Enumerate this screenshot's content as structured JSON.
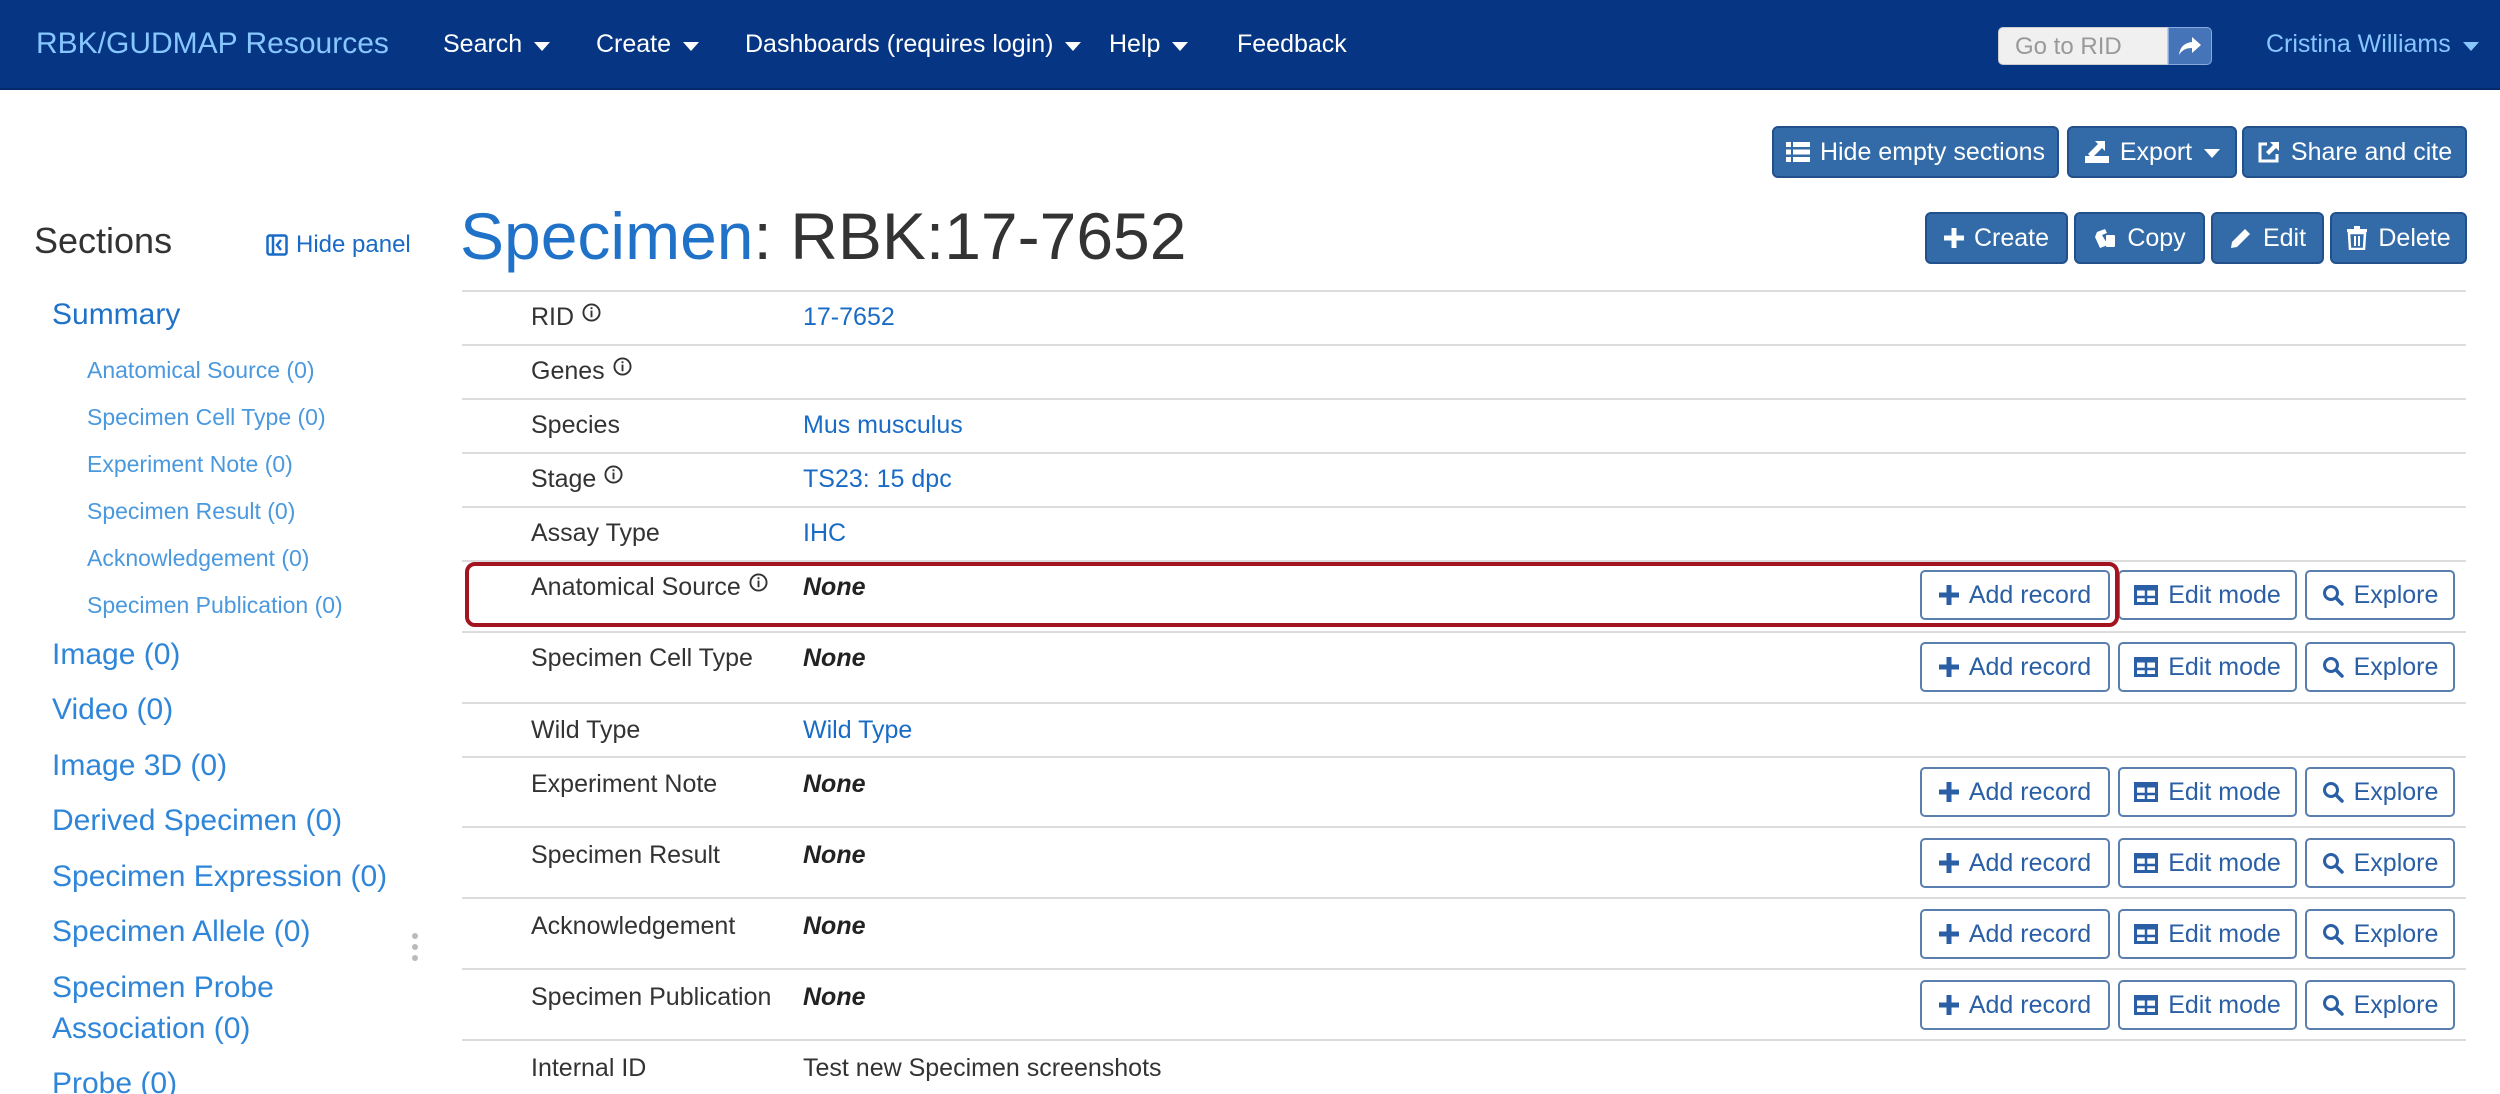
{
  "navbar": {
    "brand": "RBK/GUDMAP Resources",
    "menus": [
      {
        "label": "Search",
        "has_dropdown": true
      },
      {
        "label": "Create",
        "has_dropdown": true
      },
      {
        "label": "Dashboards (requires login)",
        "has_dropdown": true
      },
      {
        "label": "Help",
        "has_dropdown": true
      },
      {
        "label": "Feedback",
        "has_dropdown": false
      }
    ],
    "go_to_rid_placeholder": "Go to RID",
    "user": "Cristina Williams"
  },
  "page_actions": {
    "hide_empty": "Hide empty sections",
    "export": "Export",
    "share": "Share and cite"
  },
  "record_actions": {
    "create": "Create",
    "copy": "Copy",
    "edit": "Edit",
    "delete": "Delete"
  },
  "sidebar": {
    "title": "Sections",
    "hide_panel": "Hide panel",
    "summary": "Summary",
    "sub_items": [
      "Anatomical Source (0)",
      "Specimen Cell Type (0)",
      "Experiment Note (0)",
      "Specimen Result (0)",
      "Acknowledgement (0)",
      "Specimen Publication (0)"
    ],
    "main_items": [
      "Image (0)",
      "Video (0)",
      "Image 3D (0)",
      "Derived Specimen (0)",
      "Specimen Expression (0)",
      "Specimen Allele (0)",
      "Specimen Probe",
      "Association (0)",
      "Probe (0)"
    ]
  },
  "record": {
    "table_name": "Specimen",
    "separator": ":",
    "identifier": "RBK:17-7652"
  },
  "rows": [
    {
      "label": "RID",
      "value": "17-7652",
      "info": true
    },
    {
      "label": "Genes",
      "value": "",
      "info": true
    },
    {
      "label": "Species",
      "value": "Mus musculus",
      "info": false
    },
    {
      "label": "Stage",
      "value": "TS23: 15 dpc",
      "info": true
    },
    {
      "label": "Assay Type",
      "value": "IHC",
      "info": false
    },
    {
      "label": "Anatomical Source",
      "value": "None",
      "info": true
    },
    {
      "label": "Specimen Cell Type",
      "value": "None",
      "info": false
    },
    {
      "label": "Wild Type",
      "value": "Wild Type",
      "info": false
    },
    {
      "label": "Experiment Note",
      "value": "None",
      "info": false
    },
    {
      "label": "Specimen Result",
      "value": "None",
      "info": false
    },
    {
      "label": "Acknowledgement",
      "value": "None",
      "info": false
    },
    {
      "label": "Specimen Publication",
      "value": "None",
      "info": false
    },
    {
      "label": "Internal ID",
      "value": "Test new Specimen screenshots",
      "info": false
    }
  ],
  "related_actions": {
    "add": "Add record",
    "edit_mode": "Edit mode",
    "explore": "Explore"
  },
  "colors": {
    "navbar_bg": "#053583",
    "brand_link": "#87c6ff",
    "primary_button": "#336ba8",
    "link": "#1f72c8",
    "highlight_border": "#a21420"
  },
  "icons": [
    "share-arrow-icon",
    "list-icon",
    "export-icon",
    "share-icon",
    "plus-icon",
    "copy-icon",
    "pencil-icon",
    "trash-icon",
    "panel-collapse-icon",
    "info-icon",
    "table-icon",
    "search-icon",
    "drag-handle-icon"
  ]
}
